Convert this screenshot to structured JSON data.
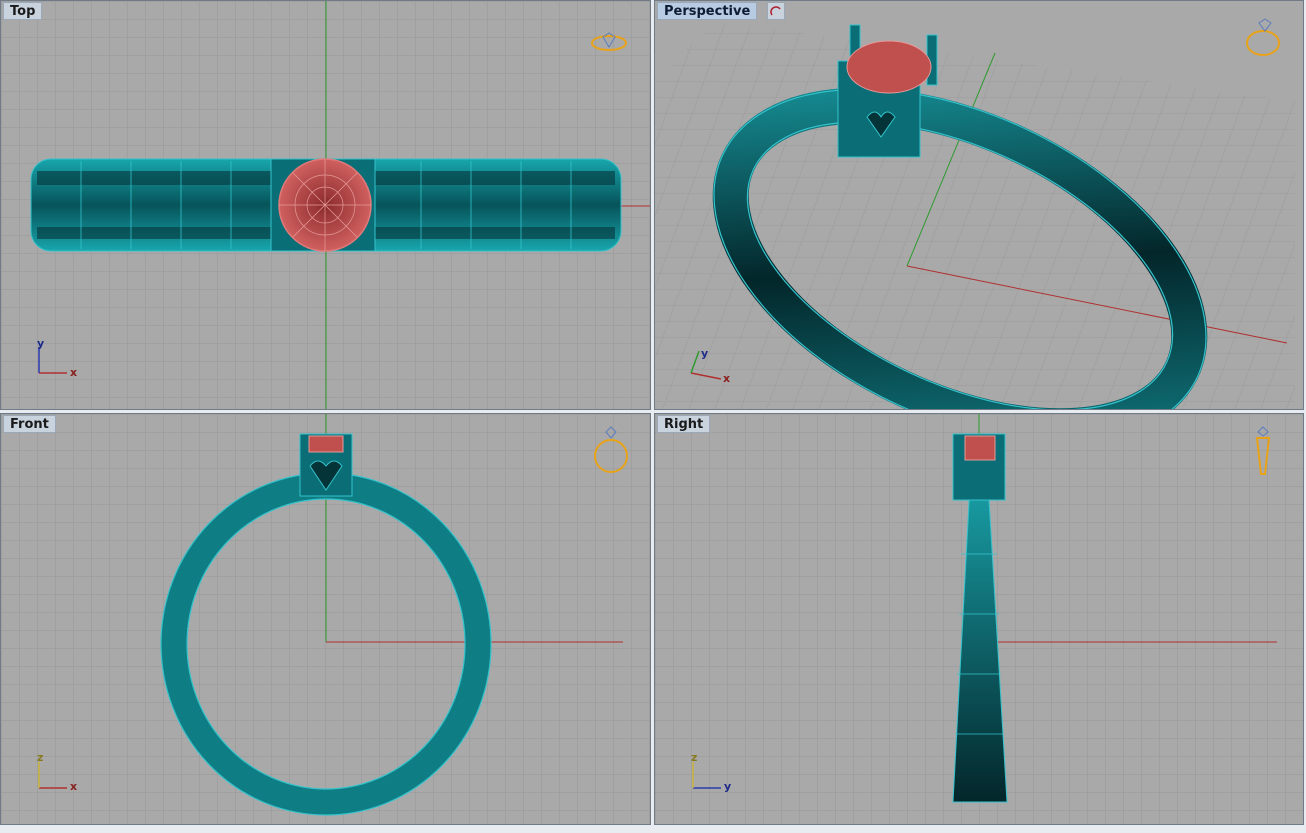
{
  "viewports": {
    "top": {
      "title": "Top",
      "axis_h": "x",
      "axis_v": "y"
    },
    "perspective": {
      "title": "Perspective",
      "axis_h": "x",
      "axis_v": "y"
    },
    "front": {
      "title": "Front",
      "axis_h": "x",
      "axis_v": "z"
    },
    "right": {
      "title": "Right",
      "axis_h": "y",
      "axis_v": "z"
    }
  },
  "colors": {
    "background": "#a9a9a9",
    "grid": "#9a9a9a",
    "ring_teal": "#0f7d84",
    "ring_wire": "#34c3cc",
    "gem_red": "#c0504d",
    "x_axis": "#b03030",
    "y_axis": "#2f9a2f",
    "nav_widget": "#e8a21a"
  },
  "icons": {
    "top": "ring-top-view-icon",
    "perspective": "ring-perspective-icon",
    "front": "ring-front-view-icon",
    "right": "ring-side-view-icon",
    "perspective_extra": "rotate-view-icon"
  }
}
